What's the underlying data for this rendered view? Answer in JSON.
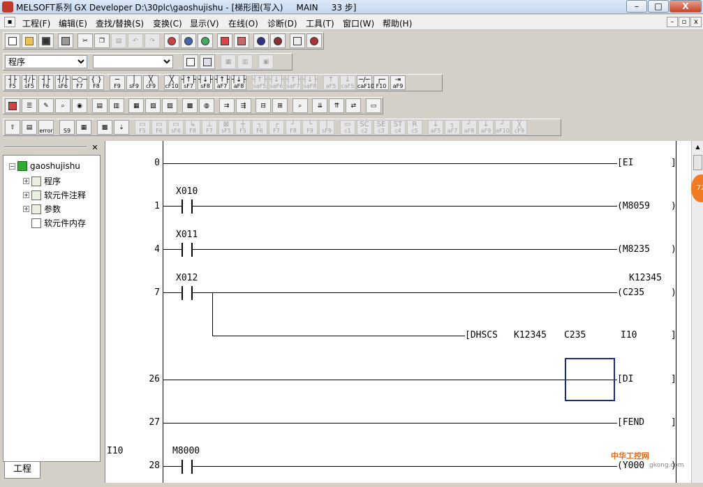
{
  "window": {
    "title": "MELSOFT系列 GX Developer D:\\30plc\\gaoshujishu - [梯形图(写入)     MAIN     33 步]",
    "minimize": "–",
    "maximize": "□",
    "close": "X"
  },
  "menu": [
    "工程(F)",
    "编辑(E)",
    "查找/替换(S)",
    "变换(C)",
    "显示(V)",
    "在线(O)",
    "诊断(D)",
    "工具(T)",
    "窗口(W)",
    "帮助(H)"
  ],
  "toolbar3": {
    "program_select": "程序",
    "second_select": ""
  },
  "ladder_keys": [
    "F5",
    "sF5",
    "F6",
    "sF6",
    "F7",
    "F8",
    "F9",
    "sF9",
    "cF9",
    "cF10",
    "sF7",
    "sF8",
    "aF7",
    "aF8",
    "saF5",
    "saF6",
    "saF7",
    "saF8",
    "aF5",
    "caF5",
    "caF10",
    "F10",
    "aF9"
  ],
  "sfc_keys": [
    "F5",
    "F6",
    "sF6",
    "F8",
    "F7",
    "sF5",
    "F5",
    "F6",
    "F7",
    "F8",
    "F9",
    "sF9",
    "c1",
    "c2",
    "c3",
    "c4",
    "c5",
    "aF5",
    "aF7",
    "aF8",
    "aF9",
    "aF10",
    "cF9"
  ],
  "sfc_syms": [
    "",
    "",
    "",
    "",
    "",
    "",
    "",
    "",
    "",
    "",
    "",
    "",
    "",
    "SC",
    "SE",
    "ST",
    "R",
    "",
    "",
    "",
    "",
    "",
    ""
  ],
  "tree": {
    "root": "gaoshujishu",
    "items": [
      "程序",
      "软元件注释",
      "参数",
      "软元件内存"
    ]
  },
  "project_tab": "工程",
  "ladder": {
    "rows": [
      {
        "step": "0",
        "coil": "[EI",
        "close": "]"
      },
      {
        "step": "1",
        "device": "X010",
        "coil": "(M8059",
        "close": ")"
      },
      {
        "step": "4",
        "device": "X011",
        "coil": "(M8235",
        "close": ")"
      },
      {
        "step": "7",
        "device": "X012",
        "coil": "(C235",
        "close": ")",
        "const": "K12345"
      },
      {
        "instr": "[DHSCS",
        "p1": "K12345",
        "p2": "C235",
        "p3": "I10",
        "close": "]"
      },
      {
        "step": "26",
        "coil": "[DI",
        "close": "]"
      },
      {
        "step": "27",
        "coil": "[FEND",
        "close": "]"
      },
      {
        "step": "28",
        "pointer": "I10",
        "device": "M8000",
        "coil": "(Y000",
        "close": ")"
      }
    ]
  },
  "watermark": {
    "text": "中华工控网",
    "site": "gkong.com"
  },
  "badge": "72"
}
